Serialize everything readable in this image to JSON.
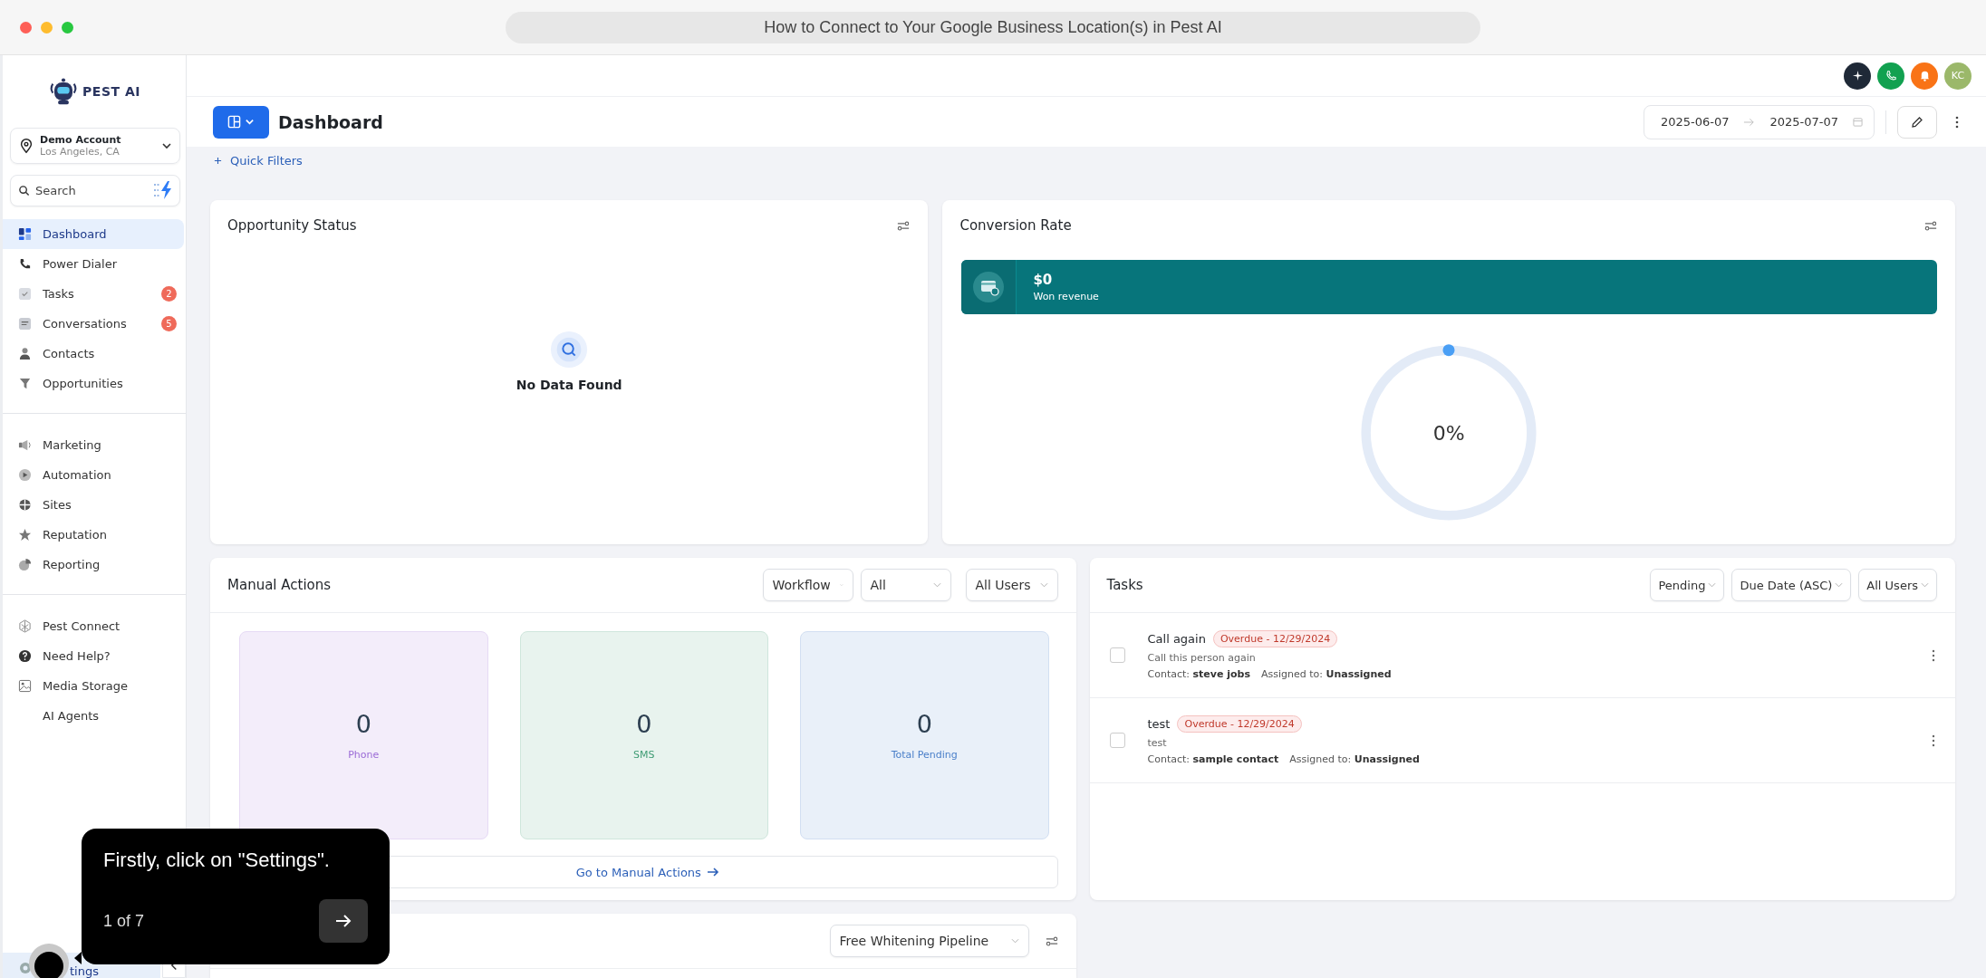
{
  "browser": {
    "title": "How to Connect to Your Google Business Location(s) in Pest AI"
  },
  "sidebar": {
    "logo": "PEST AI",
    "account": {
      "name": "Demo Account",
      "location": "Los Angeles, CA"
    },
    "search": {
      "placeholder": "Search"
    },
    "groups": [
      [
        {
          "label": "Dashboard",
          "selected": true
        },
        {
          "label": "Power Dialer",
          "selected": false
        },
        {
          "label": "Tasks",
          "selected": false,
          "badge": "2"
        },
        {
          "label": "Conversations",
          "selected": false,
          "badge": "5"
        },
        {
          "label": "Contacts",
          "selected": false
        },
        {
          "label": "Opportunities",
          "selected": false
        }
      ],
      [
        {
          "label": "Marketing",
          "selected": false
        },
        {
          "label": "Automation",
          "selected": false
        },
        {
          "label": "Sites",
          "selected": false
        },
        {
          "label": "Reputation",
          "selected": false
        },
        {
          "label": "Reporting",
          "selected": false
        }
      ],
      [
        {
          "label": "Pest Connect",
          "selected": false
        },
        {
          "label": "Need Help?",
          "selected": false
        },
        {
          "label": "Media Storage",
          "selected": false
        },
        {
          "label": "AI Agents",
          "selected": false
        }
      ]
    ],
    "settings": {
      "label": "tings",
      "selected": true
    }
  },
  "topbar": {
    "avatar": "KC"
  },
  "header": {
    "title": "Dashboard",
    "date_start": "2025-06-07",
    "date_end": "2025-07-07",
    "quick_filters": "Quick Filters"
  },
  "opportunity_status": {
    "title": "Opportunity Status",
    "empty": "No Data Found"
  },
  "conversion_rate": {
    "title": "Conversion Rate",
    "amount": "$0",
    "amount_label": "Won revenue",
    "level": 0,
    "percent": "0%"
  },
  "manual_actions": {
    "title": "Manual Actions",
    "filters": [
      "Workflow",
      "All",
      "All Users"
    ],
    "tiles": [
      {
        "value": "0",
        "label": "Phone",
        "color": "#9b6bd6"
      },
      {
        "value": "0",
        "label": "SMS",
        "color": "#3f9c74"
      },
      {
        "value": "0",
        "label": "Total Pending",
        "color": "#4a7fc9"
      }
    ],
    "link": "Go to Manual Actions"
  },
  "tasks": {
    "title": "Tasks",
    "filters": [
      "Pending",
      "Due Date (ASC)",
      "All Users"
    ],
    "items": [
      {
        "title": "Call again",
        "badge": "Overdue - 12/29/2024",
        "checked": false,
        "description": "Call this person again",
        "contact": "Contact: **steve jobs**",
        "assigned": "Assigned to: **Unassigned**"
      },
      {
        "title": "test",
        "badge": "Overdue - 12/29/2024",
        "checked": false,
        "description": "test",
        "contact": "Contact: **sample contact**",
        "assigned": "Assigned to: **Unassigned**"
      }
    ]
  },
  "pipeline": {
    "filter": "Free Whitening Pipeline"
  },
  "tour": {
    "text": "Firstly, click on \"Settings\".",
    "step": "1 of 7"
  }
}
